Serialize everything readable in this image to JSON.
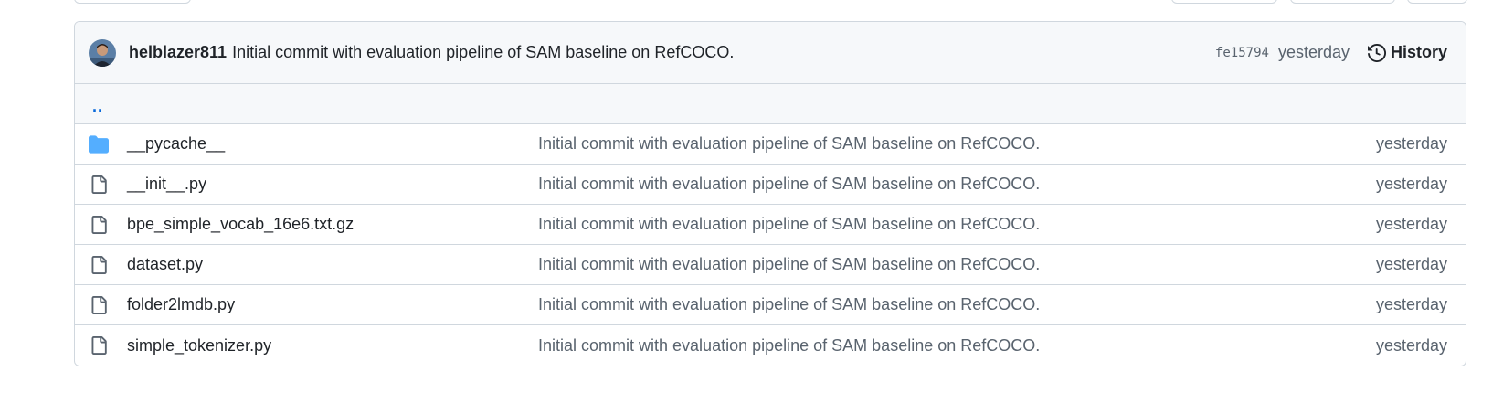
{
  "commit": {
    "author": "helblazer811",
    "message": "Initial commit with evaluation pipeline of SAM baseline on RefCOCO.",
    "sha": "fe15794",
    "date": "yesterday",
    "history_label": "History"
  },
  "parent_dir": "..",
  "files": [
    {
      "name": "__pycache__",
      "type": "folder",
      "icon": "folder-icon",
      "commit": "Initial commit with evaluation pipeline of SAM baseline on RefCOCO.",
      "date": "yesterday"
    },
    {
      "name": "__init__.py",
      "type": "file",
      "icon": "file-icon",
      "commit": "Initial commit with evaluation pipeline of SAM baseline on RefCOCO.",
      "date": "yesterday"
    },
    {
      "name": "bpe_simple_vocab_16e6.txt.gz",
      "type": "file",
      "icon": "file-icon",
      "commit": "Initial commit with evaluation pipeline of SAM baseline on RefCOCO.",
      "date": "yesterday"
    },
    {
      "name": "dataset.py",
      "type": "file",
      "icon": "file-icon",
      "commit": "Initial commit with evaluation pipeline of SAM baseline on RefCOCO.",
      "date": "yesterday"
    },
    {
      "name": "folder2lmdb.py",
      "type": "file",
      "icon": "file-icon",
      "commit": "Initial commit with evaluation pipeline of SAM baseline on RefCOCO.",
      "date": "yesterday"
    },
    {
      "name": "simple_tokenizer.py",
      "type": "file",
      "icon": "file-icon",
      "commit": "Initial commit with evaluation pipeline of SAM baseline on RefCOCO.",
      "date": "yesterday"
    }
  ],
  "colors": {
    "link": "#0969da",
    "folder": "#54aeff",
    "muted": "#59636e",
    "border": "#d0d7de",
    "header_bg": "#f6f8fa"
  }
}
